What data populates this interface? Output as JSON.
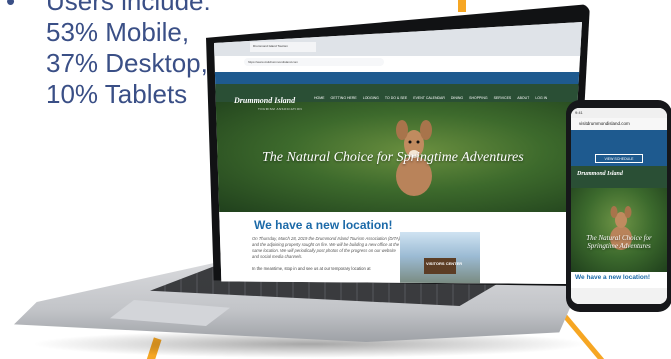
{
  "bullet": {
    "marker": "•",
    "line1": "Users include:",
    "line2": "53% Mobile,",
    "line3": "37% Desktop,",
    "line4": "10% Tablets"
  },
  "laptop": {
    "tab_title": "Drummond Island Tourism",
    "url": "https://www.visitdrummondisland.com",
    "site_logo": "Drummond Island",
    "site_logo_sub": "TOURISM ASSOCIATION",
    "nav": [
      "HOME",
      "GETTING HERE",
      "LODGING",
      "TO DO & SEE",
      "EVENT CALENDAR",
      "DINING",
      "SHOPPING",
      "SERVICES",
      "ABOUT",
      "LOG IN"
    ],
    "hero_title": "The Natural Choice for Springtime Adventures",
    "headline": "We have a new location!",
    "body_italic": "On Thursday, March 28, 2019 the Drummond Island Tourism Association (DITA) and the adjoining property sought on fire. We will be building a new office at the same location. We will periodically post photos of the progress on our website and social media channels.",
    "body_regular": "In the meantime, stop in and see us at our temporary location at",
    "photo_sign": "VISITORS CENTER"
  },
  "phone": {
    "status": "9:41",
    "url": "visitdrummondisland.com",
    "button": "VIEW SCHEDULE",
    "logo": "Drummond Island",
    "hero_title": "The Natural Choice for Springtime Adventures",
    "headline": "We have a new location!"
  },
  "colors": {
    "accent": "#f6a623",
    "text_blue": "#3a4f86",
    "link_blue": "#1c6aa8",
    "nav_green": "#2a4f35",
    "top_blue": "#1e5a8f"
  }
}
